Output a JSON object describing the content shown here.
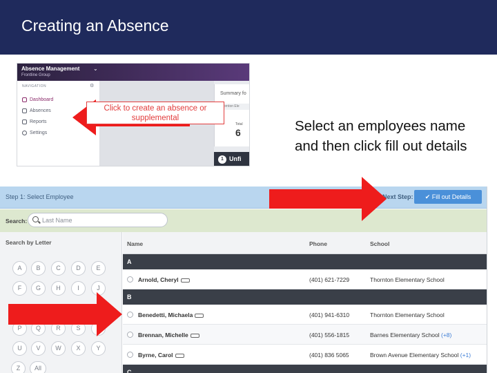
{
  "slide": {
    "title": "Creating an Absence",
    "instruction": "Select an employees name and then click fill out details"
  },
  "top_screenshot": {
    "app_title": "Absence Management",
    "app_subtitle": "Frontline Group",
    "nav_heading": "NAVIGATION",
    "nav_items": [
      {
        "label": "Dashboard",
        "icon": "clock-icon",
        "active": true
      },
      {
        "label": "Absences",
        "icon": "calendar-icon",
        "active": false
      },
      {
        "label": "Reports",
        "icon": "document-icon",
        "active": false
      },
      {
        "label": "Settings",
        "icon": "gear-icon",
        "active": false
      }
    ],
    "callout": "Click to create an absence or supplemental",
    "summary_label": "Summary fo",
    "school_label": "Thornton Ele",
    "total_label": "Total",
    "total_value": "6",
    "unfilled_count": "1",
    "unfilled_label": "Unfi"
  },
  "main_screenshot": {
    "step_label": "Step 1: Select Employee",
    "next_step_label": "Next Step:",
    "fill_button": "Fill out Details",
    "search_label": "Search:",
    "search_placeholder": "Last Name",
    "search_by_letter": "Search by Letter",
    "letters": [
      "A",
      "B",
      "C",
      "D",
      "E",
      "F",
      "G",
      "H",
      "I",
      "J",
      "P",
      "Q",
      "R",
      "S",
      "T",
      "U",
      "V",
      "W",
      "X",
      "Y",
      "Z",
      "All"
    ],
    "columns": {
      "name": "Name",
      "phone": "Phone",
      "school": "School"
    },
    "groups": [
      {
        "letter": "A",
        "employees": [
          {
            "name": "Arnold, Cheryl",
            "phone": "(401) 621-7229",
            "school": "Thornton Elementary School",
            "extra": ""
          }
        ]
      },
      {
        "letter": "B",
        "employees": [
          {
            "name": "Benedetti, Michaela",
            "phone": "(401) 941-6310",
            "school": "Thornton Elementary School",
            "extra": ""
          },
          {
            "name": "Brennan, Michelle",
            "phone": "(401) 556-1815",
            "school": "Barnes Elementary School",
            "extra": "(+8)"
          },
          {
            "name": "Byrne, Carol",
            "phone": "(401) 836 5065",
            "school": "Brown Avenue Elementary School",
            "extra": "(+1)"
          }
        ]
      },
      {
        "letter": "C",
        "employees": []
      }
    ]
  },
  "colors": {
    "title_band": "#1f2a5c",
    "arrow_red": "#ee1c1c",
    "step_bar": "#b9d6ef",
    "search_row": "#dde8cf",
    "button_blue": "#4a90d9"
  }
}
